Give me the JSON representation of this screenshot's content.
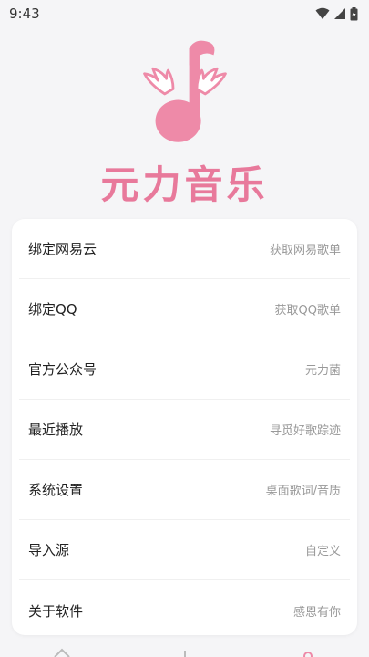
{
  "status_bar": {
    "time": "9:43"
  },
  "app": {
    "title": "元力音乐",
    "brand_color": "#e8799b"
  },
  "menu": {
    "items": [
      {
        "label": "绑定网易云",
        "hint": "获取网易歌单"
      },
      {
        "label": "绑定QQ",
        "hint": "获取QQ歌单"
      },
      {
        "label": "官方公众号",
        "hint": "元力菌"
      },
      {
        "label": "最近播放",
        "hint": "寻觅好歌踪迹"
      },
      {
        "label": "系统设置",
        "hint": "桌面歌词/音质"
      },
      {
        "label": "导入源",
        "hint": "自定义"
      },
      {
        "label": "关于软件",
        "hint": "感恩有你"
      }
    ]
  },
  "bottom_nav": {
    "icons": [
      "home-icon",
      "music-icon",
      "profile-icon"
    ]
  }
}
